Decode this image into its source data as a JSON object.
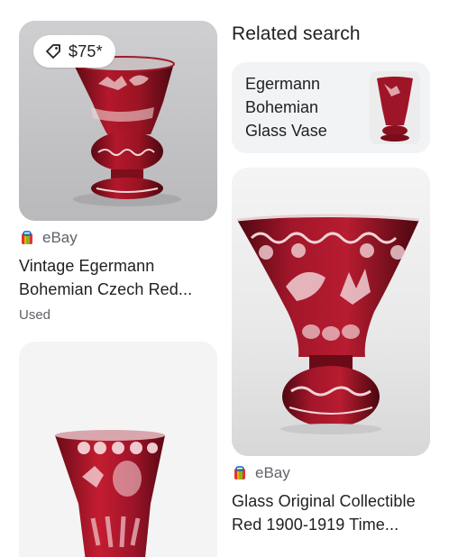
{
  "results": {
    "card1": {
      "price": "$75*",
      "source": "eBay",
      "title_line1": "Vintage Egermann",
      "title_line2": "Bohemian Czech Red...",
      "condition": "Used"
    },
    "card3": {
      "source": "eBay",
      "title_line1": "Glass Original Collectible",
      "title_line2": "Red 1900-1919 Time..."
    }
  },
  "related": {
    "heading": "Related search",
    "item": {
      "line1": "Egermann",
      "line2": "Bohemian",
      "line3": "Glass Vase"
    }
  },
  "icons": {
    "price_tag": "tag-icon",
    "source_logo": "ebay-logo-icon"
  },
  "colors": {
    "ruby": "#8b1020",
    "ruby_dark": "#5a0a14",
    "muted_text": "#5f6368",
    "related_bg": "#f1f3f4"
  }
}
